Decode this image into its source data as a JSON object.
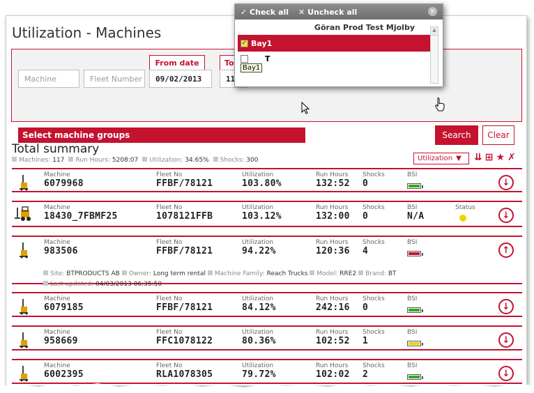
{
  "page": {
    "title": "Utilization - Machines"
  },
  "filters": {
    "machine_placeholder": "Machine",
    "fleet_placeholder": "Fleet Number",
    "from_label": "From date",
    "from_value": "09/02/2013",
    "to_label": "To",
    "to_value": "11/",
    "group_label": "Select machine groups",
    "search_label": "Search",
    "clear_label": "Clear"
  },
  "popup": {
    "check_all": "Check all",
    "uncheck_all": "Uncheck all",
    "group_name": "Göran Prod Test Mjolby",
    "item_label": "Bay1",
    "tooltip": "Bay1",
    "partial_item": "T"
  },
  "summary": {
    "title": "Total summary",
    "machines_label": "Machines:",
    "machines_value": "117",
    "runhours_label": "Run Hours:",
    "runhours_value": "5208:07",
    "util_label": "Utilization:",
    "util_value": "34.65%",
    "shocks_label": "Shocks:",
    "shocks_value": "300",
    "sort_select": "Utilization"
  },
  "labels": {
    "machine": "Machine",
    "fleet": "Fleet No",
    "utilization": "Utilization",
    "runhours": "Run Hours",
    "shocks": "Shocks",
    "bsi": "BSI",
    "status": "Status"
  },
  "rows": [
    {
      "machine": "6079968",
      "fleet": "FFBF/78121",
      "utilization": "103.80%",
      "runhours": "132:52",
      "shocks": "0",
      "bsi": "green",
      "expand": "down"
    },
    {
      "machine": "18430_7FBMF25",
      "fleet": "1078121FFB",
      "utilization": "103.12%",
      "runhours": "132:00",
      "shocks": "0",
      "bsi": "N/A",
      "status": "yellow",
      "expand": "down"
    },
    {
      "machine": "983506",
      "fleet": "FFBF/78121",
      "utilization": "94.22%",
      "runhours": "120:36",
      "shocks": "4",
      "bsi": "red",
      "expand": "up",
      "details": {
        "site_label": "Site:",
        "site": "BTPRODUCTS AB",
        "owner_label": "Owner:",
        "owner": "Long term rental",
        "family_label": "Machine Family:",
        "family": "Reach Trucks",
        "model_label": "Model:",
        "model": "RRE2",
        "brand_label": "Brand:",
        "brand": "BT",
        "updated_label": "Last updated:",
        "updated": "04/03/2013 06:35:50"
      }
    },
    {
      "machine": "6079185",
      "fleet": "FFBF/78121",
      "utilization": "84.12%",
      "runhours": "242:16",
      "shocks": "0",
      "bsi": "green",
      "expand": "down"
    },
    {
      "machine": "958669",
      "fleet": "FFC1078122",
      "utilization": "80.36%",
      "runhours": "102:52",
      "shocks": "1",
      "bsi": "yellow",
      "expand": "down"
    },
    {
      "machine": "6002395",
      "fleet": "RLA1078305",
      "utilization": "79.72%",
      "runhours": "102:02",
      "shocks": "2",
      "bsi": "green",
      "expand": "down"
    }
  ],
  "colors": {
    "accent": "#c4122f",
    "battery_green": "#3aa81e",
    "battery_yellow": "#e8d000",
    "battery_red": "#c4122f"
  }
}
